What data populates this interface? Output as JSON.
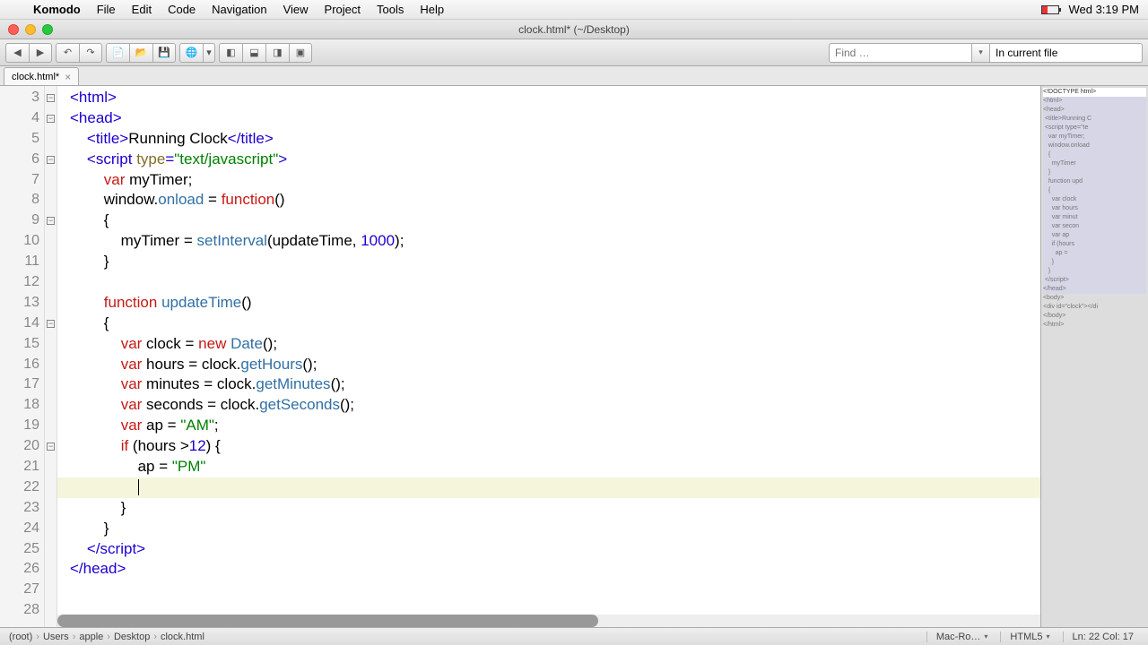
{
  "menubar": {
    "app": "Komodo",
    "items": [
      "File",
      "Edit",
      "Code",
      "Navigation",
      "View",
      "Project",
      "Tools",
      "Help"
    ],
    "clock": "Wed 3:19 PM"
  },
  "window": {
    "title": "clock.html* (~/Desktop)"
  },
  "toolbar": {
    "find_placeholder": "Find …",
    "scope": "In current file"
  },
  "tab": {
    "name": "clock.html*"
  },
  "gutter_start": 3,
  "code_lines": [
    [
      [
        "tag",
        "<html>"
      ]
    ],
    [
      [
        "tag",
        "<head>"
      ]
    ],
    [
      [
        "op",
        "    "
      ],
      [
        "tag",
        "<title>"
      ],
      [
        "op",
        "Running Clock"
      ],
      [
        "tag",
        "</title>"
      ]
    ],
    [
      [
        "op",
        "    "
      ],
      [
        "tag",
        "<script "
      ],
      [
        "attr",
        "type"
      ],
      [
        "tag",
        "="
      ],
      [
        "str",
        "\"text/javascript\""
      ],
      [
        "tag",
        ">"
      ]
    ],
    [
      [
        "op",
        "        "
      ],
      [
        "kw",
        "var"
      ],
      [
        "op",
        " myTimer;"
      ]
    ],
    [
      [
        "op",
        "        window."
      ],
      [
        "fn",
        "onload"
      ],
      [
        "op",
        " = "
      ],
      [
        "kw",
        "function"
      ],
      [
        "op",
        "()"
      ]
    ],
    [
      [
        "op",
        "        {"
      ]
    ],
    [
      [
        "op",
        "            myTimer = "
      ],
      [
        "fn",
        "setInterval"
      ],
      [
        "op",
        "(updateTime, "
      ],
      [
        "num",
        "1000"
      ],
      [
        "op",
        ");"
      ]
    ],
    [
      [
        "op",
        "        }"
      ]
    ],
    [
      [
        "op",
        ""
      ]
    ],
    [
      [
        "op",
        "        "
      ],
      [
        "kw",
        "function"
      ],
      [
        "op",
        " "
      ],
      [
        "fn",
        "updateTime"
      ],
      [
        "op",
        "()"
      ]
    ],
    [
      [
        "op",
        "        {"
      ]
    ],
    [
      [
        "op",
        "            "
      ],
      [
        "kw",
        "var"
      ],
      [
        "op",
        " clock = "
      ],
      [
        "kw",
        "new"
      ],
      [
        "op",
        " "
      ],
      [
        "fn",
        "Date"
      ],
      [
        "op",
        "();"
      ]
    ],
    [
      [
        "op",
        "            "
      ],
      [
        "kw",
        "var"
      ],
      [
        "op",
        " hours = clock."
      ],
      [
        "fn",
        "getHours"
      ],
      [
        "op",
        "();"
      ]
    ],
    [
      [
        "op",
        "            "
      ],
      [
        "kw",
        "var"
      ],
      [
        "op",
        " minutes = clock."
      ],
      [
        "fn",
        "getMinutes"
      ],
      [
        "op",
        "();"
      ]
    ],
    [
      [
        "op",
        "            "
      ],
      [
        "kw",
        "var"
      ],
      [
        "op",
        " seconds = clock."
      ],
      [
        "fn",
        "getSeconds"
      ],
      [
        "op",
        "();"
      ]
    ],
    [
      [
        "op",
        "            "
      ],
      [
        "kw",
        "var"
      ],
      [
        "op",
        " ap = "
      ],
      [
        "str",
        "\"AM\""
      ],
      [
        "op",
        ";"
      ]
    ],
    [
      [
        "op",
        "            "
      ],
      [
        "kw",
        "if"
      ],
      [
        "op",
        " (hours >"
      ],
      [
        "num",
        "12"
      ],
      [
        "op",
        ") {"
      ]
    ],
    [
      [
        "op",
        "                ap = "
      ],
      [
        "str",
        "\"PM\""
      ]
    ],
    [
      [
        "op",
        "                "
      ]
    ],
    [
      [
        "op",
        "            }"
      ]
    ],
    [
      [
        "op",
        "        }"
      ]
    ],
    [
      [
        "op",
        "    "
      ],
      [
        "tag",
        "</script>"
      ]
    ],
    [
      [
        "tag",
        "</head>"
      ]
    ],
    [
      [
        "op",
        ""
      ]
    ],
    [
      [
        "op",
        ""
      ]
    ]
  ],
  "current_line_index": 19,
  "fold_rows": [
    0,
    1,
    3,
    6,
    11,
    17
  ],
  "minimap": {
    "header": "<!DOCTYPE html>",
    "lines": [
      "<html>",
      "<head>",
      " <title>Running C",
      " <script type=\"te",
      "   var myTimer;",
      "   window.onload",
      "   {",
      "     myTimer",
      "   }",
      "",
      "   function upd",
      "   {",
      "     var clock",
      "     var hours",
      "     var minut",
      "     var secon",
      "     var ap",
      "     if (hours",
      "       ap =",
      "",
      "     }",
      "   }",
      " </script>",
      "</head>",
      "",
      "<body>",
      "<div id=\"clock\"></di",
      "</body>",
      "</html>"
    ]
  },
  "breadcrumbs": [
    "(root)",
    "Users",
    "apple",
    "Desktop",
    "clock.html"
  ],
  "status": {
    "encoding": "Mac-Ro…",
    "lang": "HTML5",
    "pos": "Ln: 22 Col: 17"
  }
}
